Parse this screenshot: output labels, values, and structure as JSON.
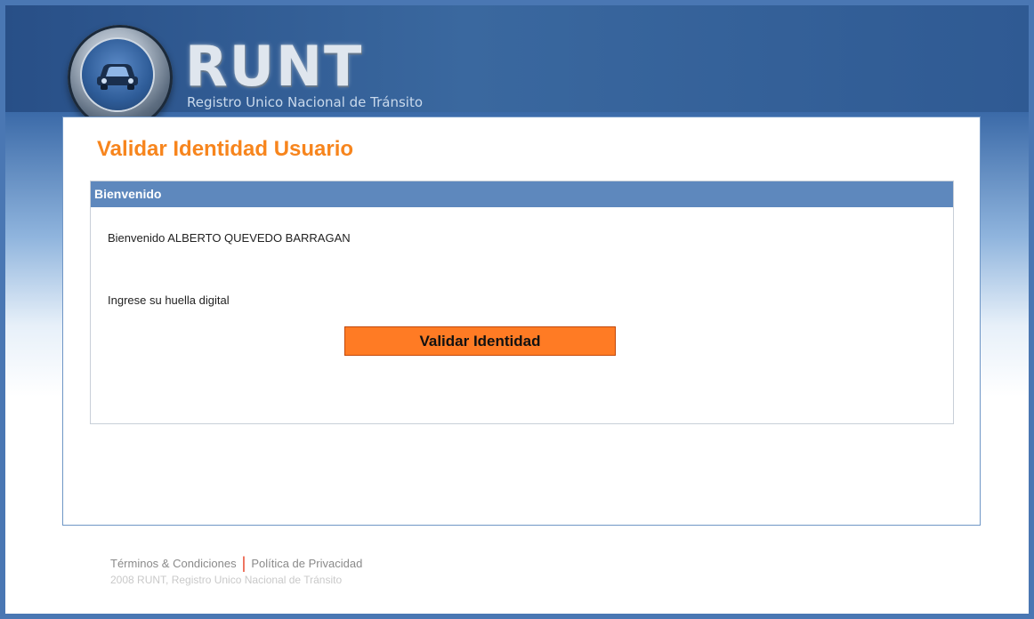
{
  "header": {
    "brand": "RUNT",
    "subtitle": "Registro Unico Nacional de Tránsito"
  },
  "main": {
    "title": "Validar Identidad Usuario",
    "panel": {
      "heading": "Bienvenido",
      "welcome_text": "Bienvenido ALBERTO QUEVEDO BARRAGAN",
      "fingerprint_label": "Ingrese su huella digital",
      "validate_button": "Validar Identidad"
    }
  },
  "footer": {
    "terms_link": "Términos & Condiciones",
    "separator": "|",
    "privacy_link": "Política de Privacidad",
    "copyright": "2008 RUNT, Registro Unico Nacional de Tránsito"
  },
  "colors": {
    "accent_orange": "#f7851d",
    "button_orange": "#ff7b24",
    "panel_header_blue": "#5e88bd",
    "frame_blue": "#4a77b3"
  },
  "icons": [
    "car-logo-icon"
  ]
}
